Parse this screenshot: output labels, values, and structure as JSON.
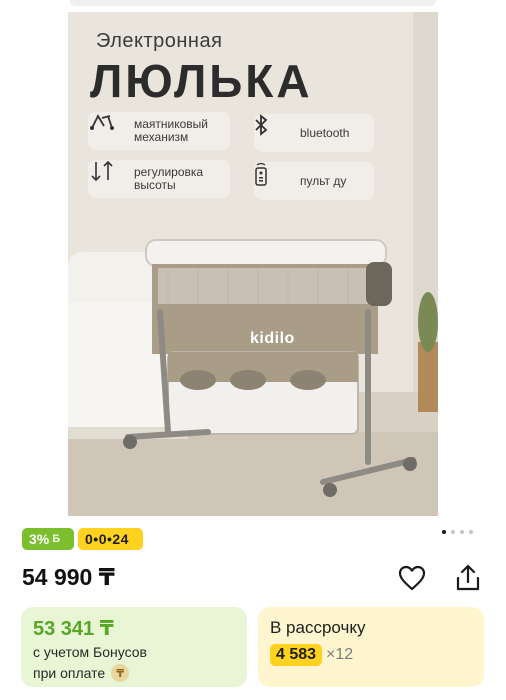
{
  "image": {
    "subtitle": "Электронная",
    "title": "ЛЮЛЬКА",
    "brand": "kidilo",
    "features": [
      {
        "icon": "pendulum-icon",
        "text": "маятниковый механизм"
      },
      {
        "icon": "bluetooth-icon",
        "text": "bluetooth"
      },
      {
        "icon": "height-adjust-icon",
        "text": "регулировка высоты"
      },
      {
        "icon": "remote-control-icon",
        "text": "пульт ду"
      }
    ],
    "carousel": {
      "total": 4,
      "active": 1
    }
  },
  "badges": {
    "bonus": "3%",
    "installment": "0•0•24"
  },
  "price": "54 990 ₸",
  "bonus_card": {
    "price": "53 341 ₸",
    "line1": "с учетом Бонусов",
    "line2": "при оплате"
  },
  "installment_card": {
    "title": "В рассрочку",
    "amount": "4 583",
    "multiplier": "×12"
  },
  "colors": {
    "accent_green": "#58a628",
    "bonus_badge": "#7bbf2f",
    "installment_yellow": "#ffd21f",
    "bonus_card_bg": "#e8f6d6",
    "installment_card_bg": "#fff6d0"
  }
}
